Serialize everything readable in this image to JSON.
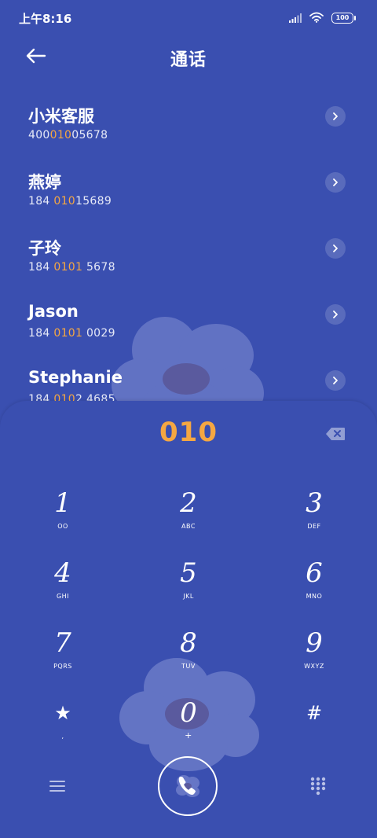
{
  "status_bar": {
    "time": "上午8:16",
    "battery": "100",
    "icons": [
      "signal-icon",
      "wifi-icon",
      "battery-icon"
    ]
  },
  "header": {
    "title": "通话",
    "back_icon": "back-arrow-icon"
  },
  "contacts": [
    {
      "name": "小米客服",
      "number_parts": [
        "400",
        "010",
        "05678"
      ]
    },
    {
      "name": "燕婷",
      "number_parts": [
        "184 ",
        "010",
        "15689"
      ]
    },
    {
      "name": "子玲",
      "number_parts": [
        "184 ",
        "0101",
        " 5678"
      ]
    },
    {
      "name": "Jason",
      "number_parts": [
        "184 ",
        "0101",
        " 0029"
      ]
    },
    {
      "name": "Stephanie",
      "number_parts": [
        "184 ",
        "010",
        "2 4685"
      ]
    }
  ],
  "dialpad": {
    "input": "010",
    "keys": [
      {
        "digit": "1",
        "letters": "OO"
      },
      {
        "digit": "2",
        "letters": "ABC"
      },
      {
        "digit": "3",
        "letters": "DEF"
      },
      {
        "digit": "4",
        "letters": "GHI"
      },
      {
        "digit": "5",
        "letters": "JKL"
      },
      {
        "digit": "6",
        "letters": "MNO"
      },
      {
        "digit": "7",
        "letters": "PQRS"
      },
      {
        "digit": "8",
        "letters": "TUV"
      },
      {
        "digit": "9",
        "letters": "WXYZ"
      },
      {
        "digit": "★",
        "letters": ","
      },
      {
        "digit": "0",
        "letters": "+"
      },
      {
        "digit": "#",
        "letters": ""
      }
    ]
  },
  "colors": {
    "background": "#3a4fb0",
    "highlight": "#f5a742",
    "flower": "#6676c6",
    "flower_center": "#5a5a9e"
  }
}
